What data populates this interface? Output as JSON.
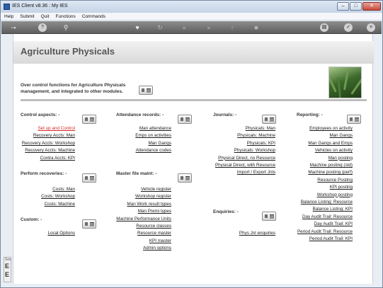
{
  "window": {
    "title": "IES Client v8.36 : My IES",
    "buttons": [
      "–",
      "□",
      "✕"
    ]
  },
  "menubar": [
    "Help",
    "Submit",
    "Quit",
    "Functions",
    "Commands"
  ],
  "toolbar": {
    "icons": [
      "key-icon",
      "help-icon",
      "search-icon",
      "heart-icon",
      "history-icon",
      "rewind-icon",
      "forward-icon",
      "upload-icon",
      "stop-icon",
      "print-icon",
      "confirm-icon",
      "close-icon"
    ],
    "help_glyph": "?",
    "confirm_glyph": "✓",
    "close_glyph": "×"
  },
  "page": {
    "title": "Agriculture Physicals",
    "intro": "Over control functions for Agriculture Physicals management, and integrated to other modules."
  },
  "sections": {
    "control": {
      "title": "Control aspects: -",
      "links": [
        "Set up and Control",
        "Recovery Accts: Man",
        "Recovery Accts: Workshop",
        "Recovery Accts: Machine",
        "Contra Accts: KPI"
      ]
    },
    "recoveries": {
      "title": "Perform recoveries: -",
      "links": [
        "Costs: Man",
        "Costs: Workshop",
        "Costs: Machine"
      ]
    },
    "custom": {
      "title": "Custom: -",
      "links": [
        "Local Options"
      ]
    },
    "attendance": {
      "title": "Attendance records: -",
      "links": [
        "Man attendance",
        "Emps on activities",
        "Man Gangs",
        "Attendance codes"
      ]
    },
    "master": {
      "title": "Master file maint: -",
      "links": [
        "Vehicle register",
        "Workshop register",
        "Man Work result types",
        "Man Premi types",
        "Machine Performance Units",
        "Resource classes",
        "Resource master",
        "KPI master",
        "Admin options"
      ]
    },
    "journals": {
      "title": "Journals: -",
      "links": [
        "Physicals: Man",
        "Physicals: Machine",
        "Physicals: KPI",
        "Physicals: Workshop",
        "Physical Direct, no Resource",
        "Physical Direct, with Resource",
        "Import / Export Jnls"
      ]
    },
    "enquiries": {
      "title": "Enquiries: -",
      "links": [
        "Phys Jnl enquiries"
      ]
    },
    "reporting": {
      "title": "Reporting: -",
      "links": [
        "Employees on activity",
        "Man Gangs",
        "Man Gangs and Emps",
        "Vehicles on activity",
        "Man posting",
        "Machine posting (std)",
        "Machine posting (perf)",
        "Resource Posting",
        "KPI posting",
        "Workshop posting",
        "Balance Listing: Resource",
        "Balance Listing: KPI",
        "Day Audit Trail: Resource",
        "Day Audit Trail: KPI",
        "Period Audit Trail: Resource",
        "Period Audit Trail: KPI"
      ]
    }
  },
  "side_tab": {
    "label": "Ses",
    "glyph1": "E",
    "glyph2": "E"
  }
}
